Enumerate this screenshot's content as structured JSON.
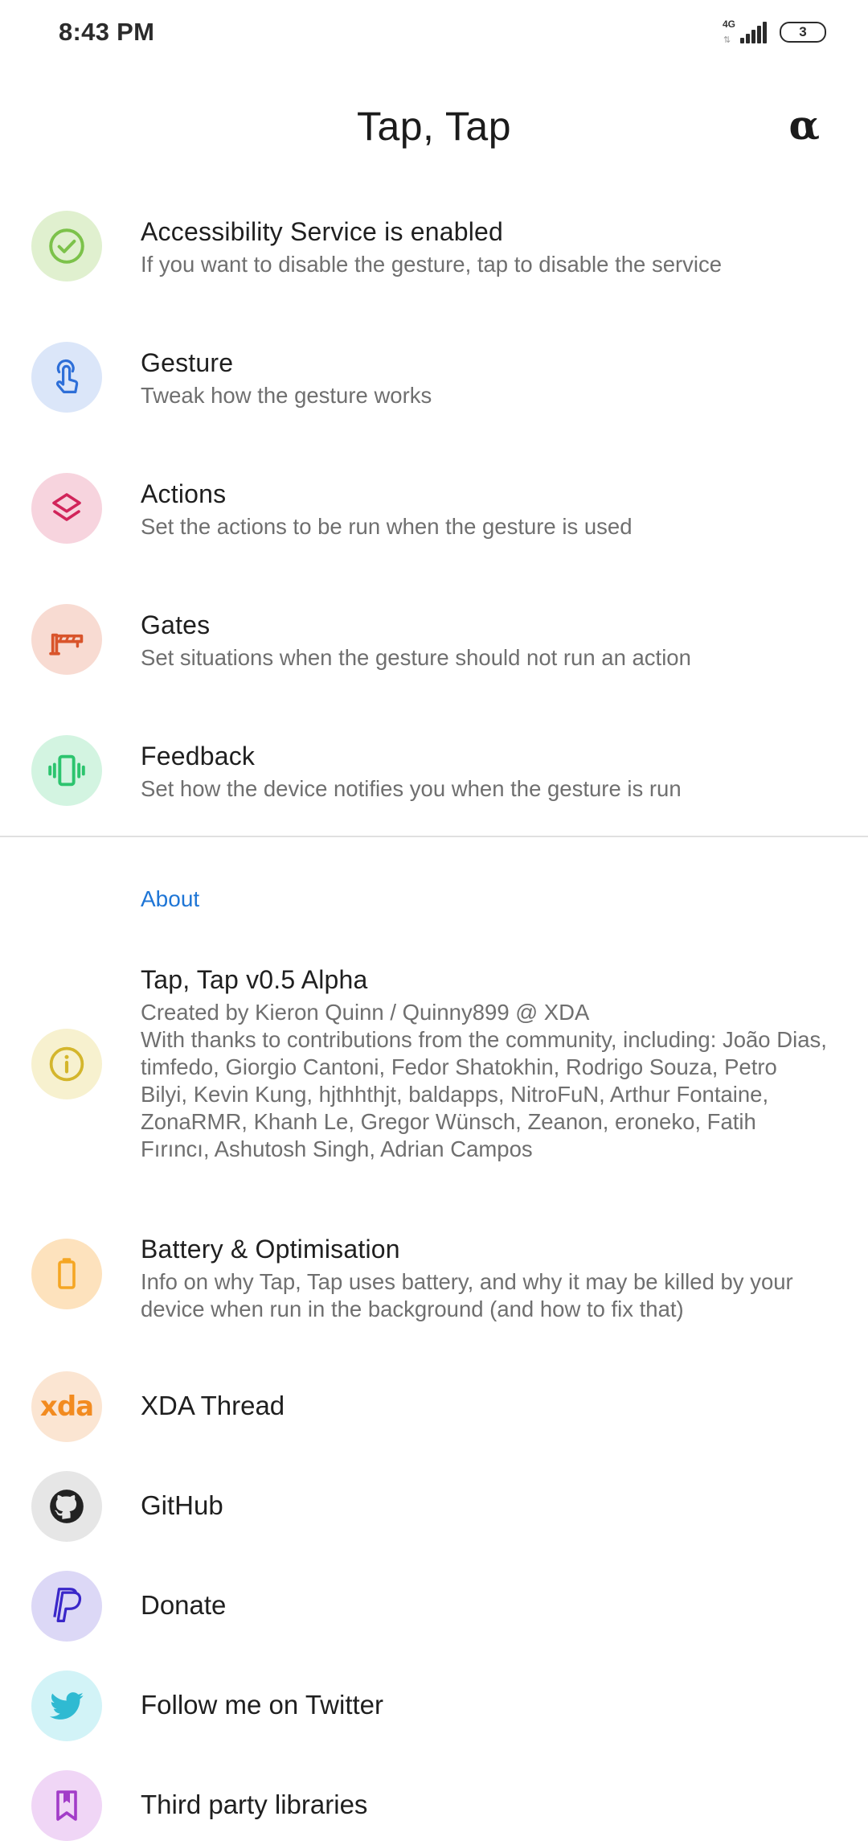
{
  "status_bar": {
    "time": "8:43 PM",
    "network": "4G",
    "battery": "3"
  },
  "header": {
    "title": "Tap, Tap",
    "alpha_label": "α"
  },
  "settings": [
    {
      "title": "Accessibility Service is enabled",
      "subtitle": "If you want to disable the gesture, tap to disable the service",
      "icon": "check-circle-icon",
      "icon_color": "#7cc24a",
      "icon_bg": "#e0f0cf"
    },
    {
      "title": "Gesture",
      "subtitle": "Tweak how the gesture works",
      "icon": "touch-icon",
      "icon_color": "#2e6fd8",
      "icon_bg": "#dbe6f9"
    },
    {
      "title": "Actions",
      "subtitle": "Set the actions to be run when the gesture is used",
      "icon": "layers-icon",
      "icon_color": "#d1245a",
      "icon_bg": "#f7d4de"
    },
    {
      "title": "Gates",
      "subtitle": "Set situations when the gesture should not run an action",
      "icon": "gate-barrier-icon",
      "icon_color": "#d9542b",
      "icon_bg": "#f8dbd2"
    },
    {
      "title": "Feedback",
      "subtitle": "Set how the device notifies you when the gesture is run",
      "icon": "vibration-icon",
      "icon_color": "#2cc46e",
      "icon_bg": "#d3f4e1"
    }
  ],
  "about": {
    "header": "About",
    "app_info": {
      "title": "Tap, Tap v0.5 Alpha",
      "subtitle": "Created by Kieron Quinn / Quinny899 @ XDA\nWith thanks to contributions from the community, including: João Dias, timfedo, Giorgio Cantoni, Fedor Shatokhin, Rodrigo Souza, Petro Bilyi, Kevin Kung, hjthhthjt, baldapps, NitroFuN, Arthur Fontaine, ZonaRMR, Khanh Le, Gregor Wünsch, Zeanon, eroneko, Fatih Fırıncı, Ashutosh Singh, Adrian Campos",
      "icon": "info-icon",
      "icon_color": "#d4b62c",
      "icon_bg": "#f7f1cf"
    },
    "battery": {
      "title": "Battery & Optimisation",
      "subtitle": "Info on why Tap, Tap uses battery, and why it may be killed by your device when run in the background (and how to fix that)",
      "icon": "battery-icon",
      "icon_color": "#f5a623",
      "icon_bg": "#fde2bd"
    },
    "links": [
      {
        "title": "XDA Thread",
        "icon": "xda-icon",
        "icon_text": "xda",
        "icon_color": "#f28b20",
        "icon_bg": "#fbe5d2"
      },
      {
        "title": "GitHub",
        "icon": "github-icon",
        "icon_color": "#222222",
        "icon_bg": "#e6e6e6"
      },
      {
        "title": "Donate",
        "icon": "paypal-icon",
        "icon_color": "#3a27c9",
        "icon_bg": "#dcd8f6"
      },
      {
        "title": "Follow me on Twitter",
        "icon": "twitter-icon",
        "icon_color": "#2fbad2",
        "icon_bg": "#d2f3f7"
      },
      {
        "title": "Third party libraries",
        "icon": "bookmark-icon",
        "icon_color": "#a23cc8",
        "icon_bg": "#f0d6f6"
      }
    ]
  }
}
